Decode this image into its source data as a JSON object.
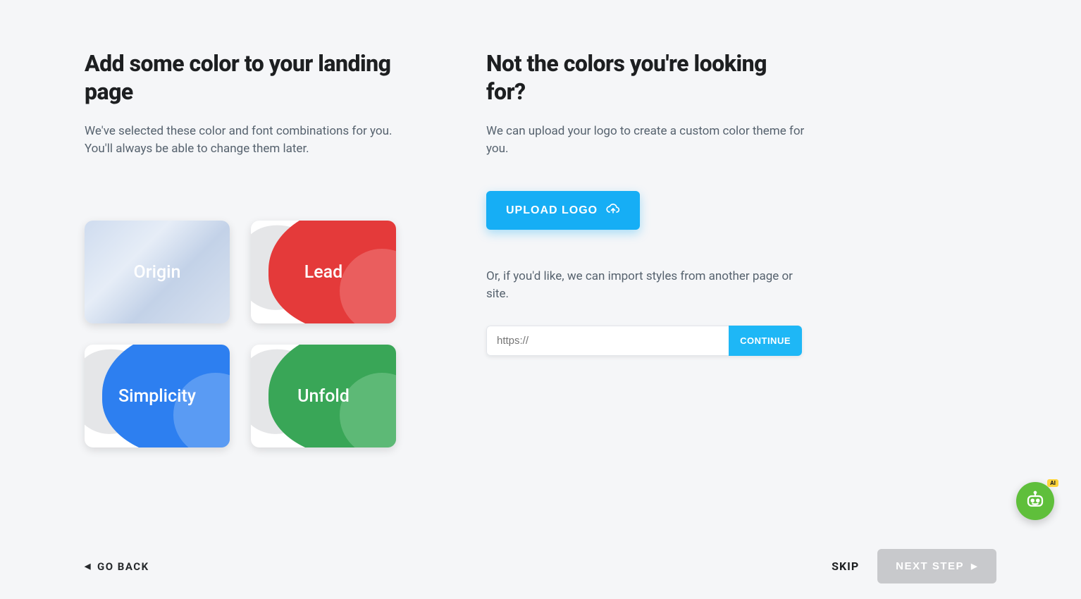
{
  "left": {
    "title": "Add some color to your landing page",
    "subhead": "We've selected these color and font combinations for you. You'll always be able to change them later.",
    "cards": [
      {
        "name": "Origin"
      },
      {
        "name": "Lead"
      },
      {
        "name": "Simplicity"
      },
      {
        "name": "Unfold"
      }
    ]
  },
  "right": {
    "title": "Not the colors you're looking for?",
    "subhead": "We can upload your logo to create a custom color theme for you.",
    "upload_label": "UPLOAD LOGO",
    "or_text": "Or, if you'd like, we can import styles from another page or site.",
    "url_placeholder": "https://",
    "continue_label": "CONTINUE"
  },
  "footer": {
    "go_back": "GO BACK",
    "skip": "SKIP",
    "next": "NEXT STEP"
  },
  "chat": {
    "badge": "AI"
  }
}
